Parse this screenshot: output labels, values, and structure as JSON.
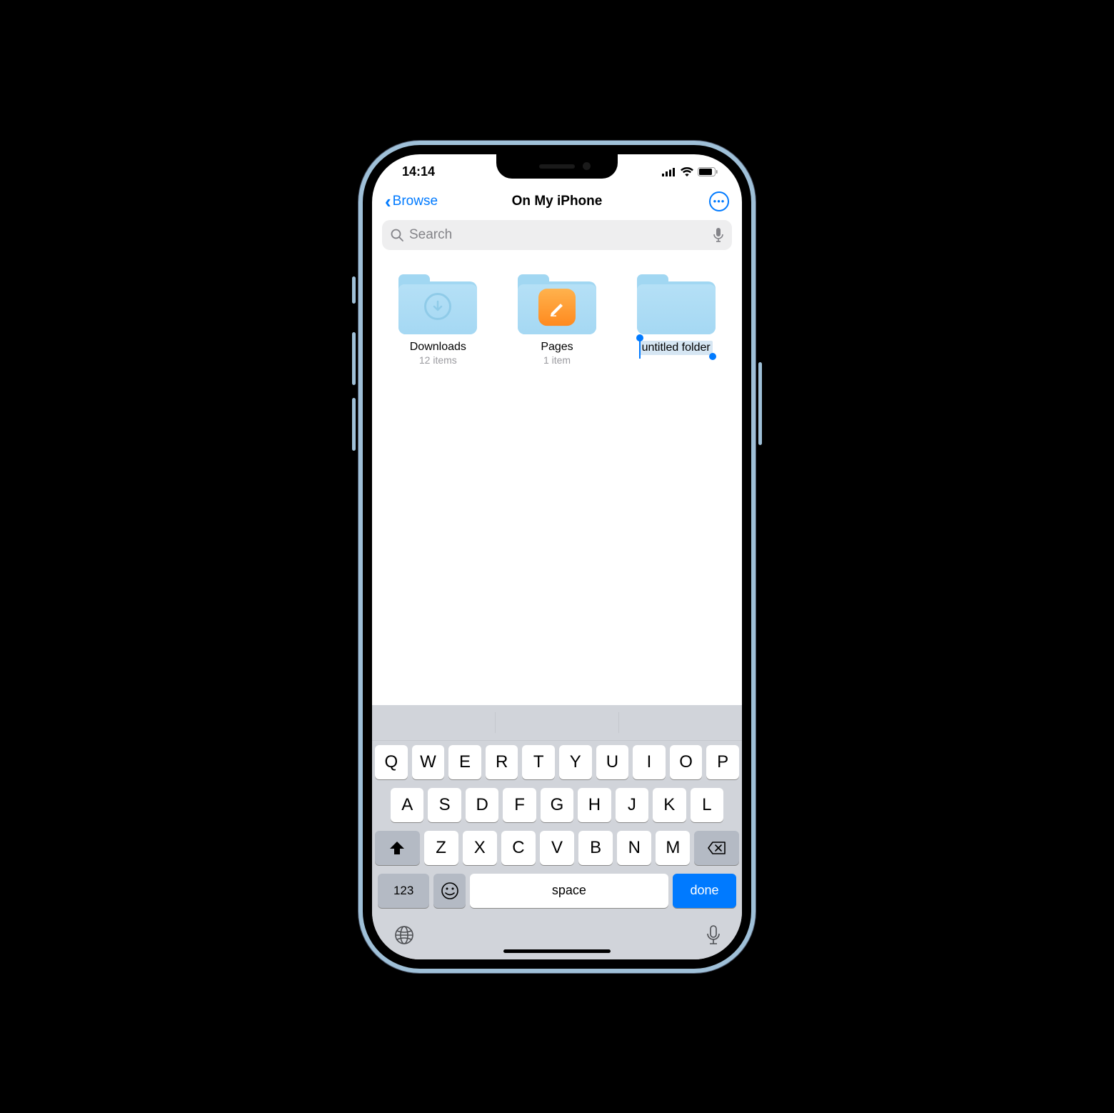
{
  "status": {
    "time": "14:14"
  },
  "nav": {
    "back": "Browse",
    "title": "On My iPhone"
  },
  "search": {
    "placeholder": "Search"
  },
  "folders": [
    {
      "name": "Downloads",
      "sub": "12 items",
      "type": "download"
    },
    {
      "name": "Pages",
      "sub": "1 item",
      "type": "pages"
    },
    {
      "name": "untitled folder",
      "sub": "",
      "type": "plain",
      "editing": true
    }
  ],
  "keyboard": {
    "row1": [
      "Q",
      "W",
      "E",
      "R",
      "T",
      "Y",
      "U",
      "I",
      "O",
      "P"
    ],
    "row2": [
      "A",
      "S",
      "D",
      "F",
      "G",
      "H",
      "J",
      "K",
      "L"
    ],
    "row3": [
      "Z",
      "X",
      "C",
      "V",
      "B",
      "N",
      "M"
    ],
    "num": "123",
    "space": "space",
    "done": "done"
  }
}
